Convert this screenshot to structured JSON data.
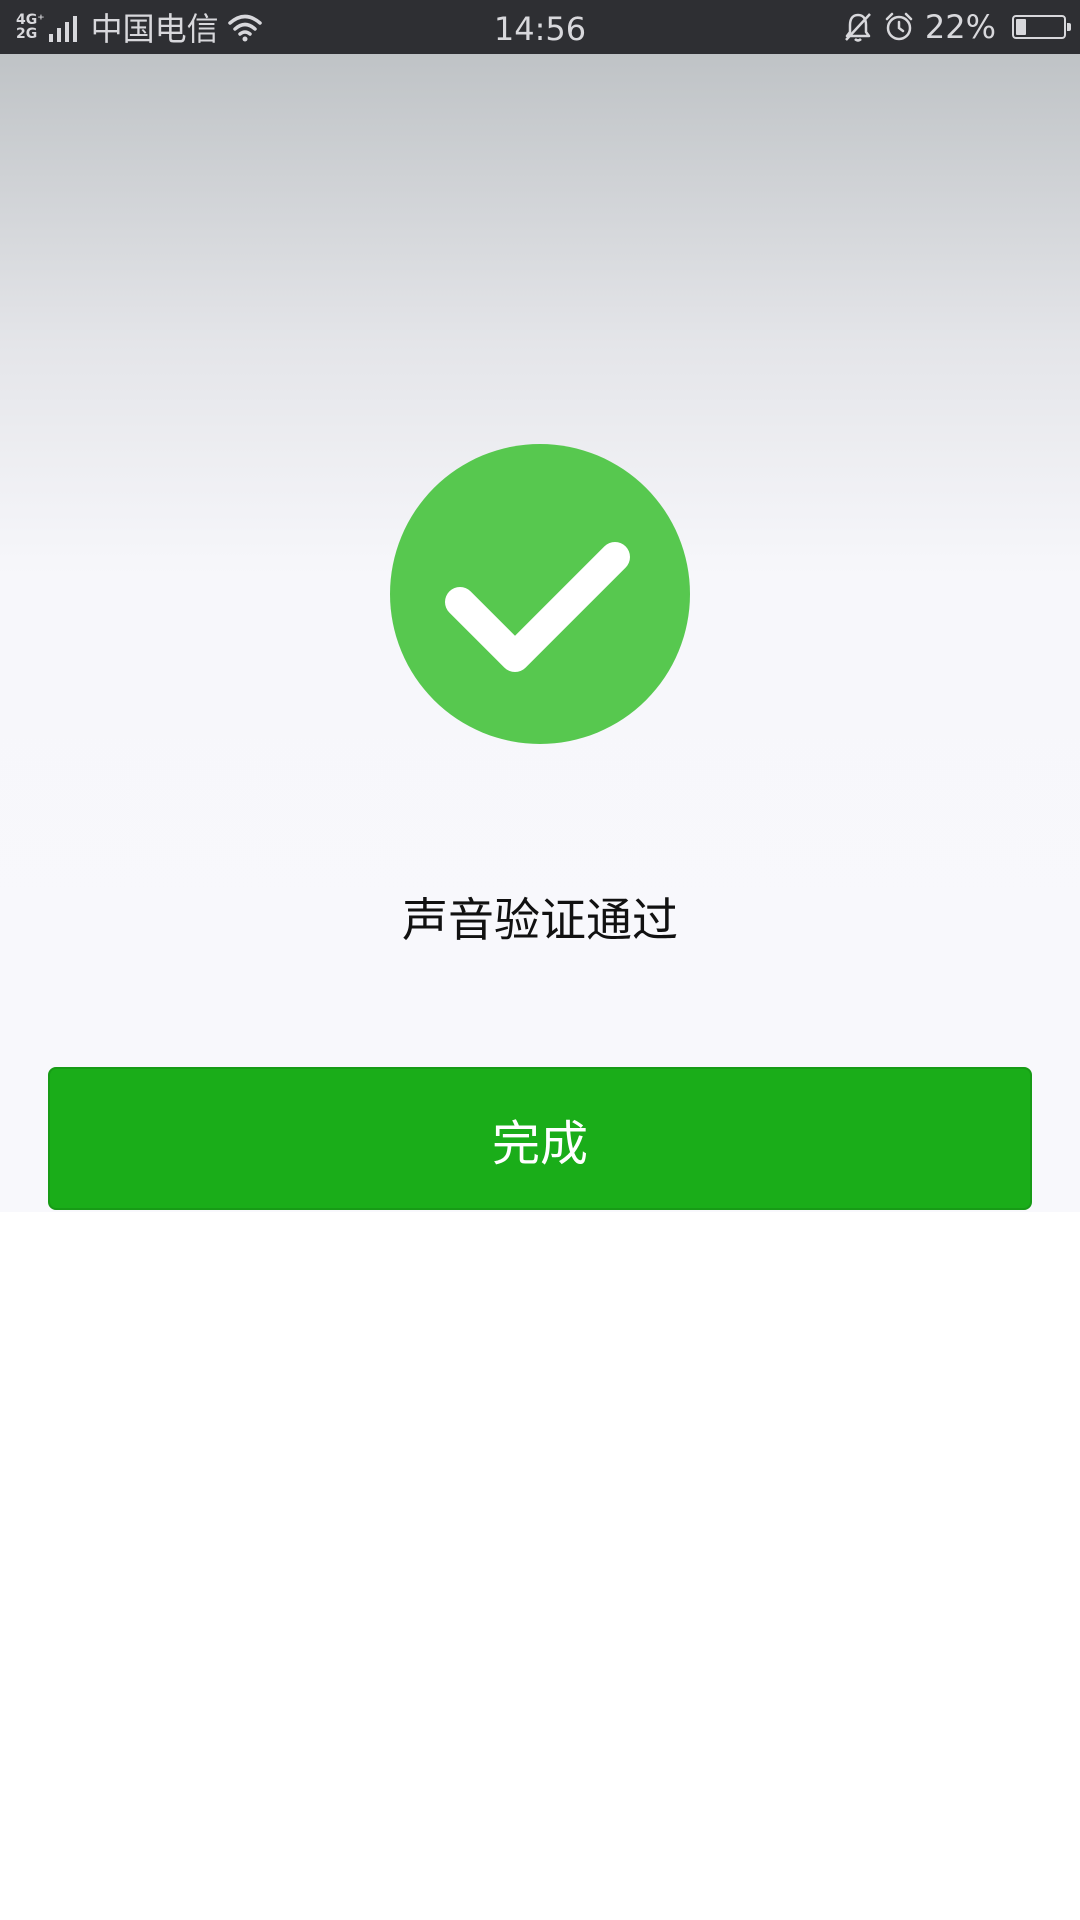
{
  "status_bar": {
    "network_type_top": "4G⁺",
    "network_type_bottom": "2G",
    "carrier": "中国电信",
    "time": "14:56",
    "battery_percent": "22%",
    "battery_level": 0.22,
    "icons": [
      "signal-icon",
      "wifi-icon",
      "mute-bell-icon",
      "alarm-icon",
      "battery-icon"
    ]
  },
  "main": {
    "status_icon": "checkmark-circle-icon",
    "status_text": "声音验证通过",
    "done_button_label": "完成"
  },
  "colors": {
    "success_green": "#57c84f",
    "button_green": "#1aad19",
    "status_bar_bg": "#2e2f33"
  }
}
